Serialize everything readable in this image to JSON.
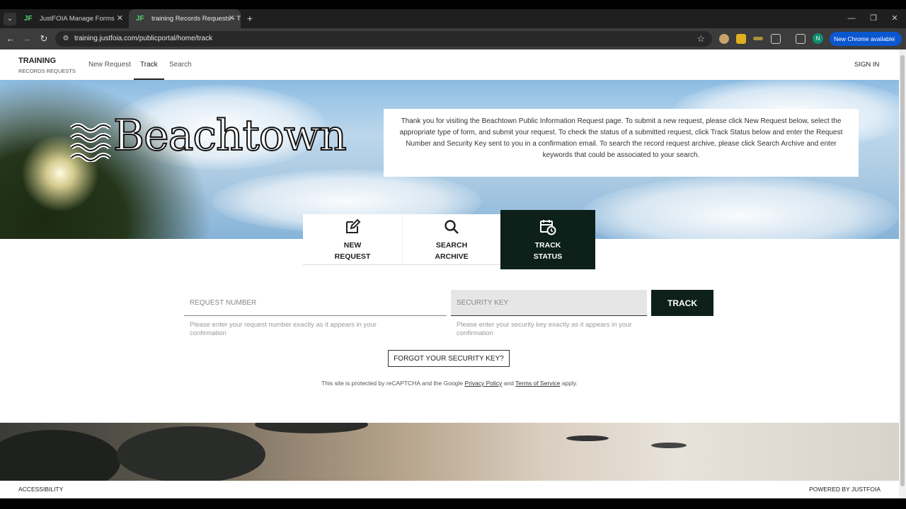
{
  "browser": {
    "tabs": [
      {
        "title": "JustFOIA Manage Forms",
        "favicon": "JF"
      },
      {
        "title": "training Records Requests - Tra",
        "favicon": "JF"
      }
    ],
    "url": "training.justfoia.com/publicportal/home/track",
    "profile_initial": "N",
    "update_label": "New Chrome available"
  },
  "header": {
    "brand_title": "TRAINING",
    "brand_subtitle": "RECORDS REQUESTS",
    "nav": [
      "New Request",
      "Track",
      "Search"
    ],
    "active_nav": "Track",
    "sign_in": "SIGN IN"
  },
  "hero": {
    "logo_text": "Beachtown",
    "intro": "Thank you for visiting the Beachtown Public Information Request page. To submit a new request, please click New Request below, select the appropriate type of form, and submit your request. To check the status of a submitted request, click Track Status below and enter the Request Number and Security Key sent to you in a confirmation email. To search the record request archive, please click Search Archive and enter keywords that could be associated to your search."
  },
  "actions": [
    {
      "line1": "NEW",
      "line2": "REQUEST",
      "icon": "edit-icon"
    },
    {
      "line1": "SEARCH",
      "line2": "ARCHIVE",
      "icon": "search-icon"
    },
    {
      "line1": "TRACK",
      "line2": "STATUS",
      "icon": "calendar-clock-icon"
    }
  ],
  "track_form": {
    "request_placeholder": "REQUEST NUMBER",
    "request_value": "",
    "request_hint": "Please enter your request number exactly as it appears in your confirmation",
    "security_placeholder": "SECURITY KEY",
    "security_value": "",
    "security_hint": "Please enter your security key exactly as it appears in your confirmation",
    "track_label": "TRACK",
    "forgot_label": "FORGOT YOUR SECURITY KEY?"
  },
  "recaptcha": {
    "prefix": "This site is protected by reCAPTCHA and the Google",
    "privacy": "Privacy Policy",
    "and": "and",
    "terms": "Terms of Service",
    "suffix": "apply."
  },
  "footer": {
    "left": "ACCESSIBILITY",
    "right": "POWERED BY JUSTFOIA"
  },
  "colors": {
    "primary_dark": "#0d2019",
    "chrome_update": "#0b57d0"
  }
}
